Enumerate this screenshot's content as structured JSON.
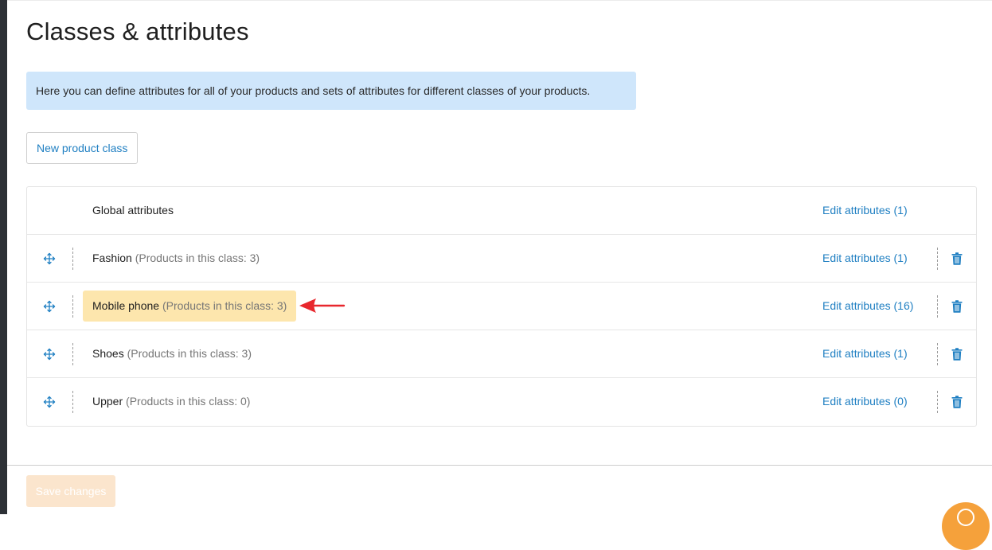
{
  "page": {
    "title": "Classes & attributes",
    "info": "Here you can define attributes for all of your products and sets of attributes for different classes of your products."
  },
  "actions": {
    "new_class_label": "New product class",
    "save_label": "Save changes"
  },
  "global_row": {
    "name": "Global attributes",
    "edit_label": "Edit attributes (1)"
  },
  "classes": [
    {
      "name": "Fashion",
      "count_text": "(Products in this class: 3)",
      "edit_label": "Edit attributes (1)",
      "highlighted": false
    },
    {
      "name": "Mobile phone",
      "count_text": "(Products in this class: 3)",
      "edit_label": "Edit attributes (16)",
      "highlighted": true
    },
    {
      "name": "Shoes",
      "count_text": "(Products in this class: 3)",
      "edit_label": "Edit attributes (1)",
      "highlighted": false
    },
    {
      "name": "Upper",
      "count_text": "(Products in this class: 0)",
      "edit_label": "Edit attributes (0)",
      "highlighted": false
    }
  ],
  "icons": {
    "drag": "move-arrows-icon",
    "delete": "trash-icon",
    "annotation": "red-arrow-icon",
    "help": "help-bubble-icon"
  },
  "colors": {
    "link": "#1f7fc2",
    "info_bg": "#cfe6fb",
    "highlight_bg": "#fde6ad",
    "save_disabled_bg": "#fbe5cd",
    "annotation_red": "#e8272d",
    "help_orange": "#f5a13b"
  }
}
